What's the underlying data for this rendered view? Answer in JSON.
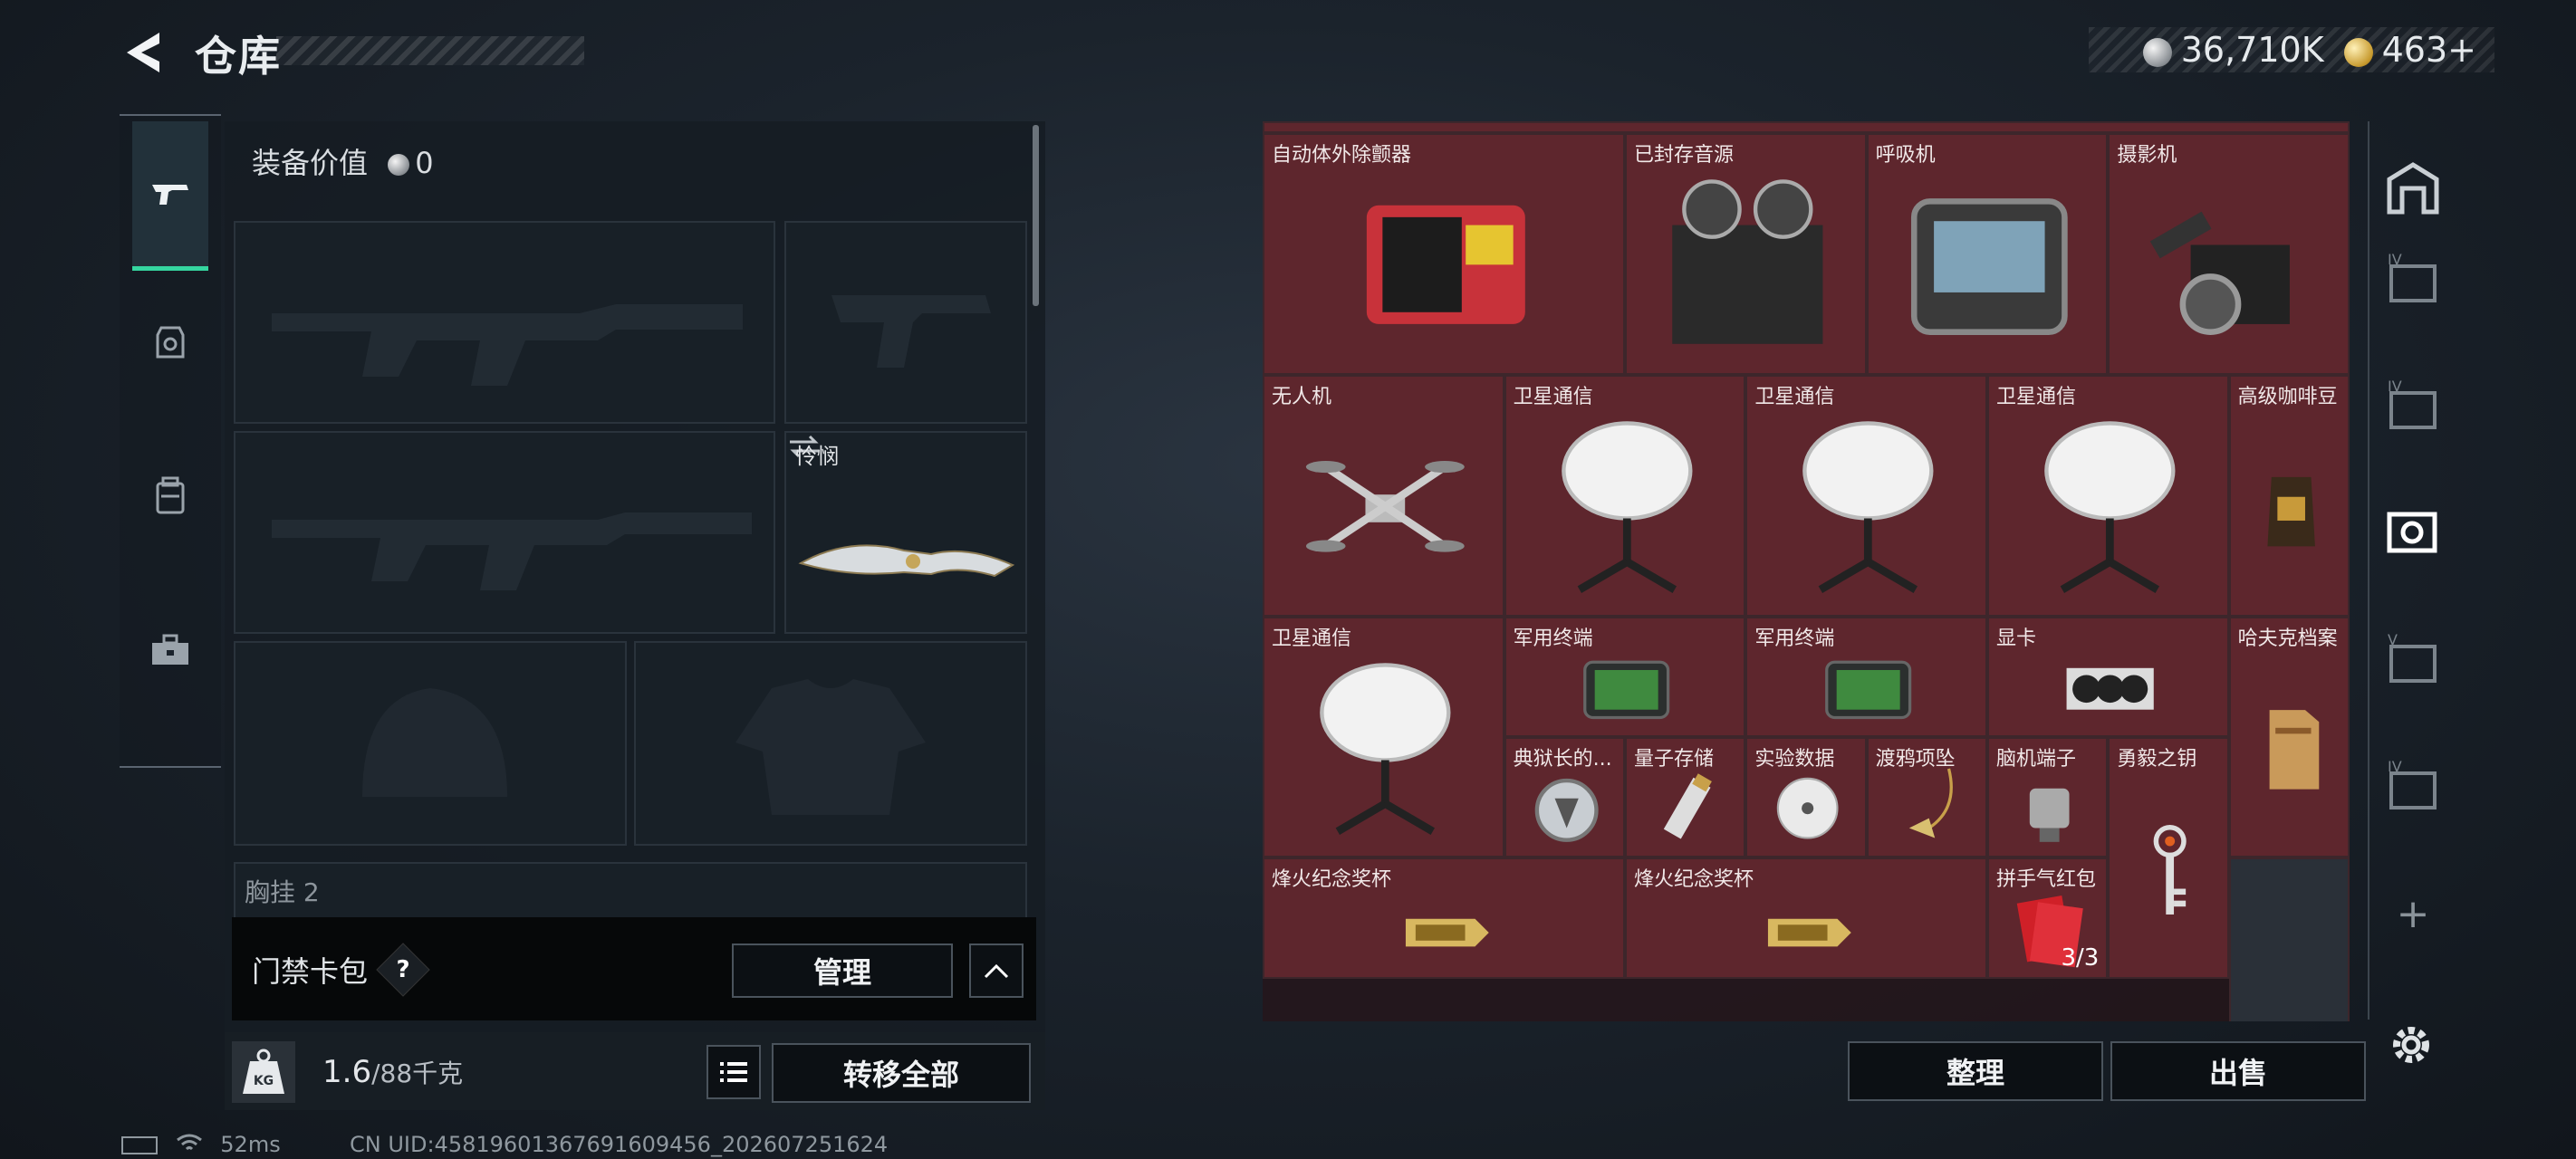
{
  "header": {
    "title": "仓库",
    "silver": "36,710K",
    "gold": "463",
    "gold_plus": "+"
  },
  "equipment": {
    "value_label": "装备价值",
    "value": "0",
    "knife_label": "怜悯",
    "chest_label": "胸挂",
    "chest_count": "2"
  },
  "card_pack": {
    "label": "门禁卡包",
    "help": "?",
    "manage": "管理"
  },
  "weight": {
    "current": "1.6",
    "max": "/88千克",
    "kg_icon_text": "KG",
    "transfer_all": "转移全部"
  },
  "inventory": {
    "items": [
      {
        "label": "自动体外除颤器",
        "rarity": "red",
        "icon": "defibrillator-icon"
      },
      {
        "label": "已封存音源",
        "rarity": "red",
        "icon": "tape-recorder-icon"
      },
      {
        "label": "呼吸机",
        "rarity": "red",
        "icon": "ventilator-icon"
      },
      {
        "label": "摄影机",
        "rarity": "red",
        "icon": "camera-icon"
      },
      {
        "label": "无人机",
        "rarity": "red",
        "icon": "drone-icon"
      },
      {
        "label": "卫星通信",
        "rarity": "red",
        "icon": "satellite-dish-icon"
      },
      {
        "label": "卫星通信",
        "rarity": "red",
        "icon": "satellite-dish-icon"
      },
      {
        "label": "卫星通信",
        "rarity": "red",
        "icon": "satellite-dish-icon"
      },
      {
        "label": "高级咖啡豆",
        "rarity": "red",
        "icon": "coffee-bag-icon"
      },
      {
        "label": "卫星通信",
        "rarity": "red",
        "icon": "satellite-dish-icon"
      },
      {
        "label": "军用终端",
        "rarity": "red",
        "icon": "military-terminal-icon"
      },
      {
        "label": "军用终端",
        "rarity": "red",
        "icon": "military-terminal-icon"
      },
      {
        "label": "显卡",
        "rarity": "red",
        "icon": "graphics-card-icon"
      },
      {
        "label": "哈夫克档案",
        "rarity": "red",
        "icon": "folder-icon"
      },
      {
        "label": "典狱长的...",
        "rarity": "red",
        "icon": "badge-icon"
      },
      {
        "label": "量子存储",
        "rarity": "red",
        "icon": "usb-drive-icon"
      },
      {
        "label": "实验数据",
        "rarity": "red",
        "icon": "disc-icon"
      },
      {
        "label": "渡鸦项坠",
        "rarity": "red",
        "icon": "pendant-icon"
      },
      {
        "label": "脑机端子",
        "rarity": "red",
        "icon": "neural-plug-icon"
      },
      {
        "label": "勇毅之钥",
        "rarity": "red",
        "icon": "key-icon"
      },
      {
        "label": "烽火纪念奖杯",
        "rarity": "red",
        "icon": "trophy-icon"
      },
      {
        "label": "烽火纪念奖杯",
        "rarity": "red",
        "icon": "trophy-icon"
      },
      {
        "label": "拼手气红包",
        "rarity": "red",
        "icon": "red-envelope-icon",
        "count": "3/3"
      }
    ],
    "sort_label": "整理",
    "sell_label": "出售"
  },
  "rail": {
    "levels": [
      "IV",
      "IV",
      "V",
      "IV"
    ],
    "add": "+"
  },
  "status": {
    "ping": "52ms",
    "uid": "CN UID:4581960136769160945​6_202607251624"
  },
  "colors": {
    "accent_green": "#35d6a0",
    "red_rarity": "#5e262d"
  }
}
